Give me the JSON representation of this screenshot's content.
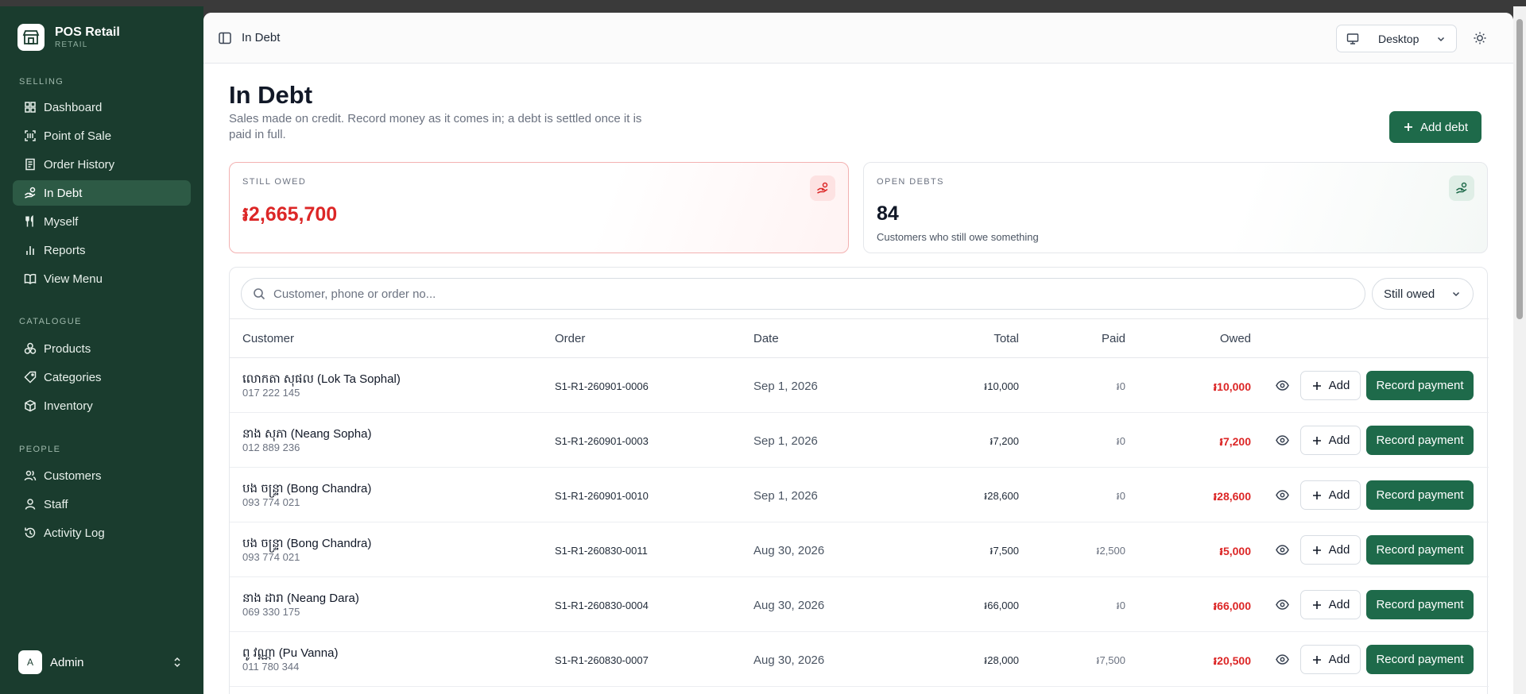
{
  "brand": {
    "name": "POS Retail",
    "sub": "RETAIL"
  },
  "sidebar": {
    "sections": [
      {
        "label": "SELLING"
      },
      {
        "label": "CATALOGUE"
      },
      {
        "label": "PEOPLE"
      }
    ],
    "items": [
      {
        "label": "Dashboard",
        "icon": "grid-icon"
      },
      {
        "label": "Point of Sale",
        "icon": "scan-icon"
      },
      {
        "label": "Order History",
        "icon": "receipt-icon"
      },
      {
        "label": "In Debt",
        "icon": "hand-coins-icon",
        "active": true
      },
      {
        "label": "Myself",
        "icon": "utensils-icon"
      },
      {
        "label": "Reports",
        "icon": "bar-chart-icon"
      },
      {
        "label": "View Menu",
        "icon": "book-open-icon"
      },
      {
        "label": "Products",
        "icon": "boxes-icon"
      },
      {
        "label": "Categories",
        "icon": "tag-icon"
      },
      {
        "label": "Inventory",
        "icon": "package-icon"
      },
      {
        "label": "Customers",
        "icon": "users-icon"
      },
      {
        "label": "Staff",
        "icon": "user-icon"
      },
      {
        "label": "Activity Log",
        "icon": "history-icon"
      }
    ],
    "user": {
      "initial": "A",
      "name": "Admin"
    }
  },
  "header": {
    "title": "In Debt",
    "device": "Desktop"
  },
  "page": {
    "title": "In Debt",
    "description": "Sales made on credit. Record money as it comes in; a debt is settled once it is paid in full.",
    "add_debt_label": "Add debt"
  },
  "cards": {
    "owed": {
      "label": "STILL OWED",
      "value": "៛2,665,700"
    },
    "open": {
      "label": "OPEN DEBTS",
      "value": "84",
      "sub": "Customers who still owe something"
    }
  },
  "search": {
    "placeholder": "Customer, phone or order no..."
  },
  "filter": {
    "selected": "Still owed"
  },
  "table": {
    "headers": {
      "customer": "Customer",
      "order": "Order",
      "date": "Date",
      "total": "Total",
      "paid": "Paid",
      "owed": "Owed"
    },
    "add_label": "Add",
    "pay_label": "Record payment",
    "rows": [
      {
        "name": "លោកតា សុផល (Lok Ta Sophal)",
        "phone": "017 222 145",
        "order": "S1-R1-260901-0006",
        "date": "Sep 1, 2026",
        "total": "៛10,000",
        "paid": "៛0",
        "owed": "៛10,000"
      },
      {
        "name": "នាង សុភា (Neang Sopha)",
        "phone": "012 889 236",
        "order": "S1-R1-260901-0003",
        "date": "Sep 1, 2026",
        "total": "៛7,200",
        "paid": "៛0",
        "owed": "៛7,200"
      },
      {
        "name": "បង ចន្ទ្រា (Bong Chandra)",
        "phone": "093 774 021",
        "order": "S1-R1-260901-0010",
        "date": "Sep 1, 2026",
        "total": "៛28,600",
        "paid": "៛0",
        "owed": "៛28,600"
      },
      {
        "name": "បង ចន្ទ្រា (Bong Chandra)",
        "phone": "093 774 021",
        "order": "S1-R1-260830-0011",
        "date": "Aug 30, 2026",
        "total": "៛7,500",
        "paid": "៛2,500",
        "owed": "៛5,000"
      },
      {
        "name": "នាង ដារា (Neang Dara)",
        "phone": "069 330 175",
        "order": "S1-R1-260830-0004",
        "date": "Aug 30, 2026",
        "total": "៛66,000",
        "paid": "៛0",
        "owed": "៛66,000"
      },
      {
        "name": "ពូ វណ្ណា (Pu Vanna)",
        "phone": "011 780 344",
        "order": "S1-R1-260830-0007",
        "date": "Aug 30, 2026",
        "total": "៛28,000",
        "paid": "៛7,500",
        "owed": "៛20,500"
      }
    ]
  }
}
